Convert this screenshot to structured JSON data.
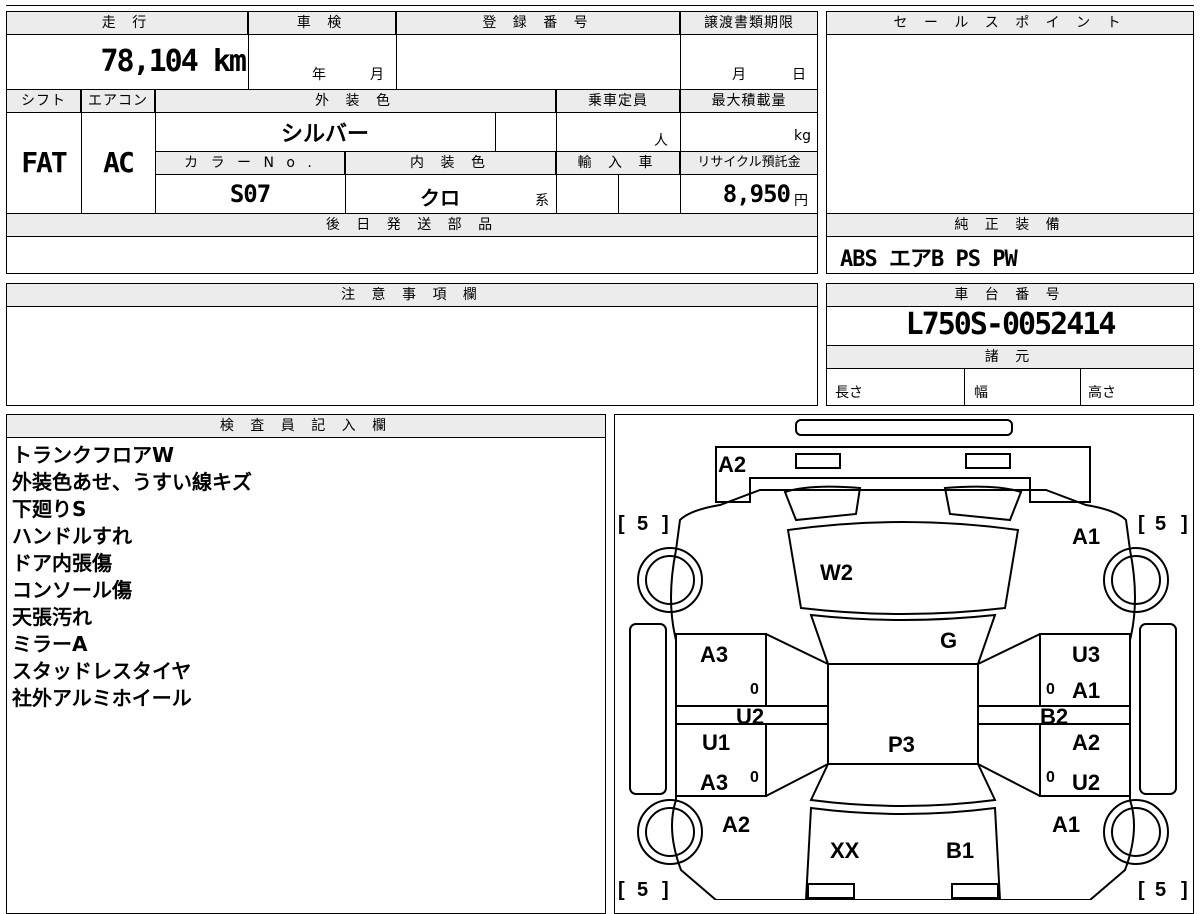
{
  "sheet": {
    "mileage_label": "走 行",
    "mileage": "78,104 km",
    "shaken_label": "車 検",
    "shaken_year": "年",
    "shaken_month": "月",
    "reg_label": "登 録 番 号",
    "transfer_label": "譲渡書類期限",
    "transfer_month": "月",
    "transfer_day": "日",
    "shift_label": "シフト",
    "shift": "FAT",
    "ac_label": "エアコン",
    "ac": "AC",
    "exterior_color_label": "外 装 色",
    "exterior_color": "シルバー",
    "capacity_label": "乗車定員",
    "capacity_unit": "人",
    "max_load_label": "最大積載量",
    "max_load_unit": "kg",
    "color_no_label": "カ ラ ー N o .",
    "color_no": "S07",
    "interior_color_label": "内 装 色",
    "interior_color": "クロ",
    "interior_suffix": "系",
    "import_label": "輸 入 車",
    "recycle_label": "リサイクル預託金",
    "recycle_value": "8,950",
    "recycle_unit": "円",
    "later_parts_label": "後 日 発 送 部 品",
    "sales_point_label": "セ ー ル ス ポ イ ン ト",
    "factory_equip_label": "純 正 装 備",
    "factory_equip": "ABS エアB PS PW",
    "notes_label": "注 意 事 項 欄",
    "chassis_label": "車 台 番 号",
    "chassis_no": "L750S-0052414",
    "specs_label": "諸 元",
    "length_label": "長さ",
    "width_label": "幅",
    "height_label": "高さ",
    "inspector_label": "検 査 員 記 入 欄",
    "inspector_notes": [
      "トランクフロアW",
      "外装色あせ、うすい線キズ",
      "下廻りS",
      "ハンドルすれ",
      "ドア内張傷",
      "コンソール傷",
      "天張汚れ",
      "ミラーA",
      "スタッドレスタイヤ",
      "社外アルミホイール"
    ]
  },
  "diagram": {
    "tire_rating": "5",
    "marks": {
      "trunk": "A2",
      "rear_window": "W2",
      "rear_right_quarter": "A1",
      "roof": "G",
      "rear_left_door": "A3",
      "rear_right_door": "U3",
      "rear_right_door_2": "A1",
      "left_sill": "U2",
      "right_sill": "B2",
      "front_left_door": "U1",
      "front_left_door_2": "A3",
      "front_right_door": "A2",
      "front_right_door_2": "U2",
      "seats": "P3",
      "front_left_fender": "A2",
      "front_right_fender": "A1",
      "hood_left": "XX",
      "hood_right": "B1",
      "zero": "0"
    }
  }
}
